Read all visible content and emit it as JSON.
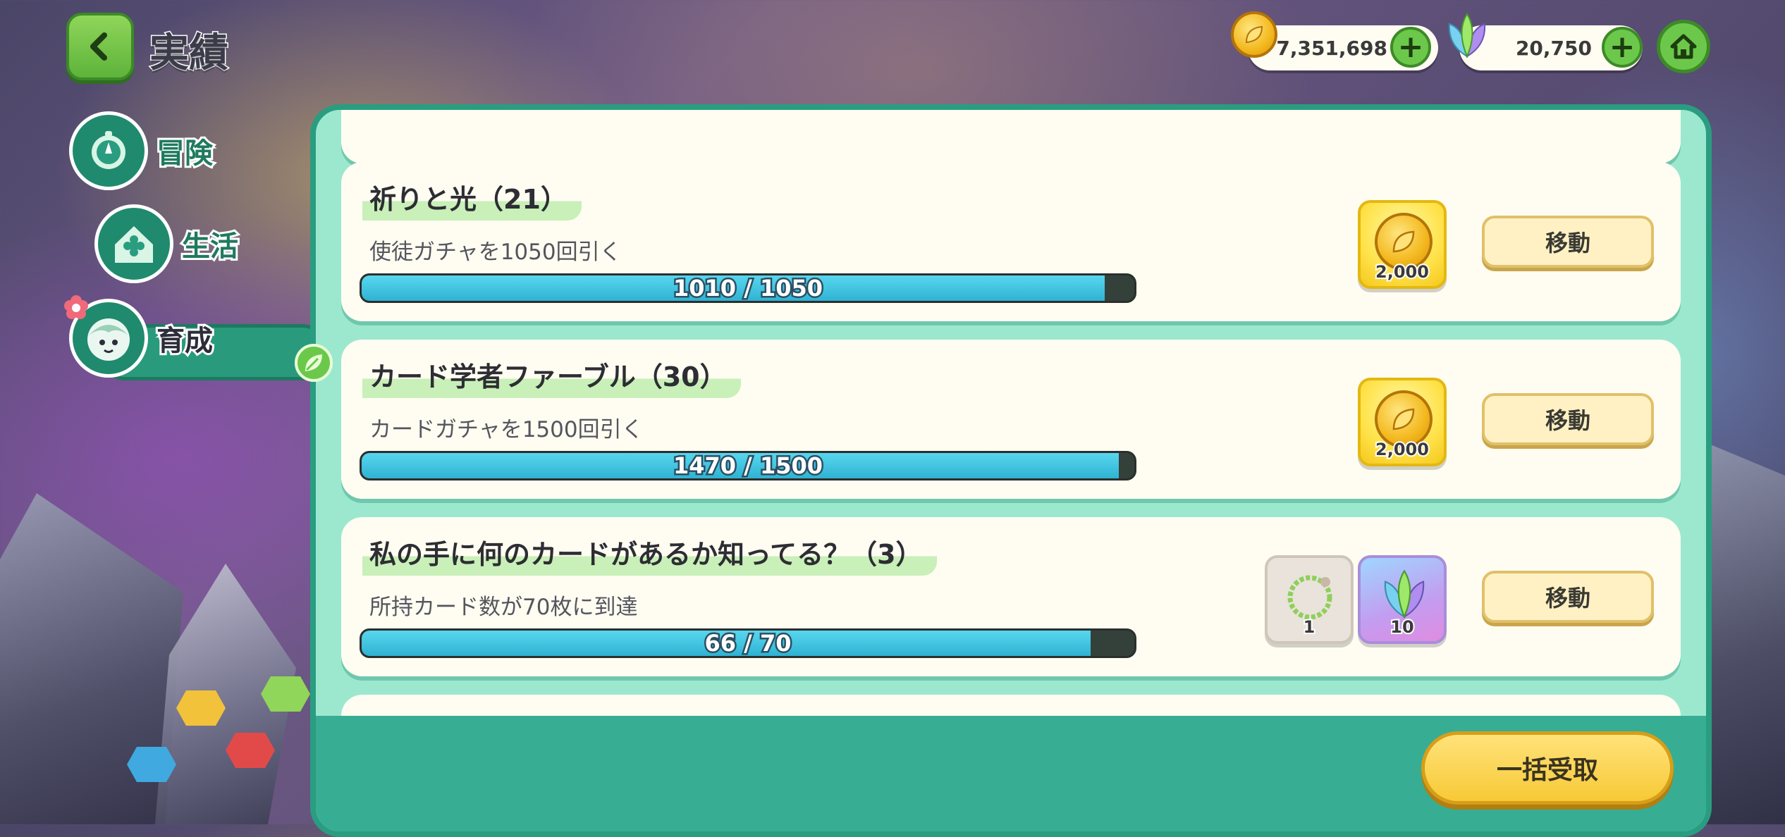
{
  "header": {
    "title": "実績"
  },
  "categories": [
    {
      "label": "冒険",
      "icon": "compass-icon",
      "active": false
    },
    {
      "label": "生活",
      "icon": "house-clover-icon",
      "active": false
    },
    {
      "label": "育成",
      "icon": "character-face-icon",
      "active": true
    }
  ],
  "currency": {
    "coins": "7,351,698",
    "leaf_gems": "20,750"
  },
  "achievements": [
    {
      "title": "祈りと光（21）",
      "description": "使徒ガチャを1050回引く",
      "progress_text": "1010 / 1050",
      "progress": 0.962,
      "rewards": [
        {
          "type": "coin",
          "count": "2,000"
        }
      ],
      "button": "移動"
    },
    {
      "title": "カード学者ファーブル（30）",
      "description": "カードガチャを1500回引く",
      "progress_text": "1470 / 1500",
      "progress": 0.98,
      "rewards": [
        {
          "type": "coin",
          "count": "2,000"
        }
      ],
      "button": "移動"
    },
    {
      "title": "私の手に何のカードがあるか知ってる？（3）",
      "description": "所持カード数が70枚に到達",
      "progress_text": "66 / 70",
      "progress": 0.943,
      "rewards": [
        {
          "type": "ring",
          "count": "1"
        },
        {
          "type": "leaf-gem",
          "count": "10"
        }
      ],
      "button": "移動"
    }
  ],
  "footer": {
    "claim_all": "一括受取"
  },
  "colors": {
    "accent_green": "#6cc84a",
    "panel_teal": "#2a9d80",
    "progress_blue": "#2fb3d3",
    "button_gold": "#f7c936"
  }
}
